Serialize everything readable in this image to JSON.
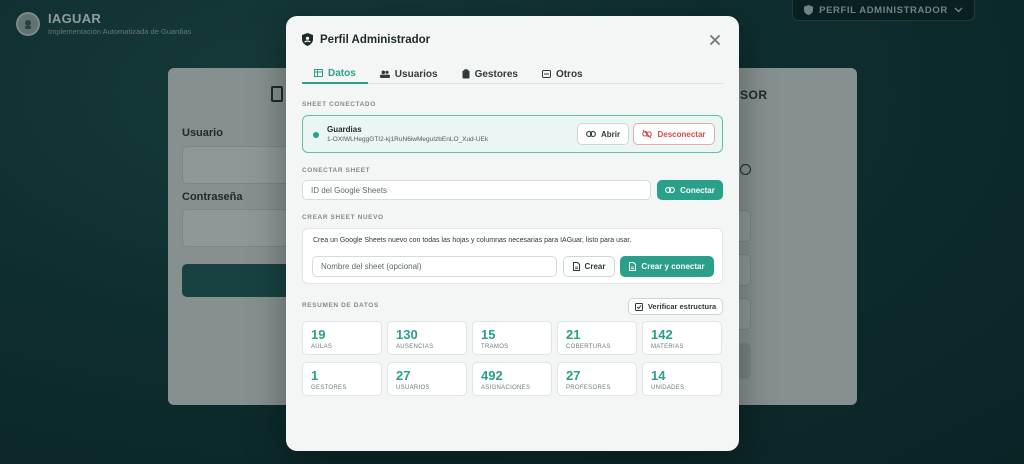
{
  "app": {
    "name": "IAGUAR",
    "subtitle": "Implementación Automatizada de Guardias",
    "profile_button": "PERFIL ADMINISTRADOR"
  },
  "login": {
    "user_label": "Usuario",
    "password_label": "Contraseña",
    "right_title": "SOR"
  },
  "modal": {
    "title": "Perfil Administrador",
    "tabs": [
      {
        "label": "Datos",
        "icon": "table-icon",
        "active": true
      },
      {
        "label": "Usuarios",
        "icon": "users-icon",
        "active": false
      },
      {
        "label": "Gestores",
        "icon": "clipboard-icon",
        "active": false
      },
      {
        "label": "Otros",
        "icon": "window-icon",
        "active": false
      }
    ],
    "sheet_section": {
      "heading": "SHEET CONECTADO",
      "name": "Guardias",
      "id": "1-OXIWLHeggGTI2-kj1RuN6iwMeguIzbEnLO_Xud-UEk",
      "open_label": "Abrir",
      "disconnect_label": "Desconectar"
    },
    "connect_section": {
      "heading": "CONECTAR SHEET",
      "placeholder": "ID del Google Sheets",
      "connect_label": "Conectar"
    },
    "create_section": {
      "heading": "CREAR SHEET NUEVO",
      "description": "Crea un Google Sheets nuevo con todas las hojas y columnas necesarias para IAGuar, listo para usar.",
      "placeholder": "Nombre del sheet (opcional)",
      "create_label": "Crear",
      "create_connect_label": "Crear y conectar"
    },
    "summary": {
      "heading": "RESUMEN DE DATOS",
      "verify_label": "Verificar estructura",
      "stats": [
        {
          "value": "19",
          "label": "AULAS"
        },
        {
          "value": "130",
          "label": "AUSENCIAS"
        },
        {
          "value": "15",
          "label": "TRAMOS"
        },
        {
          "value": "21",
          "label": "COBERTURAS"
        },
        {
          "value": "142",
          "label": "MATERIAS"
        },
        {
          "value": "1",
          "label": "GESTORES"
        },
        {
          "value": "27",
          "label": "USUARIOS"
        },
        {
          "value": "492",
          "label": "ASIGNACIONES"
        },
        {
          "value": "27",
          "label": "PROFESORES"
        },
        {
          "value": "14",
          "label": "UNIDADES"
        }
      ]
    }
  },
  "colors": {
    "accent": "#2aa08a",
    "danger": "#d24a4a",
    "background": "#0f3332"
  }
}
